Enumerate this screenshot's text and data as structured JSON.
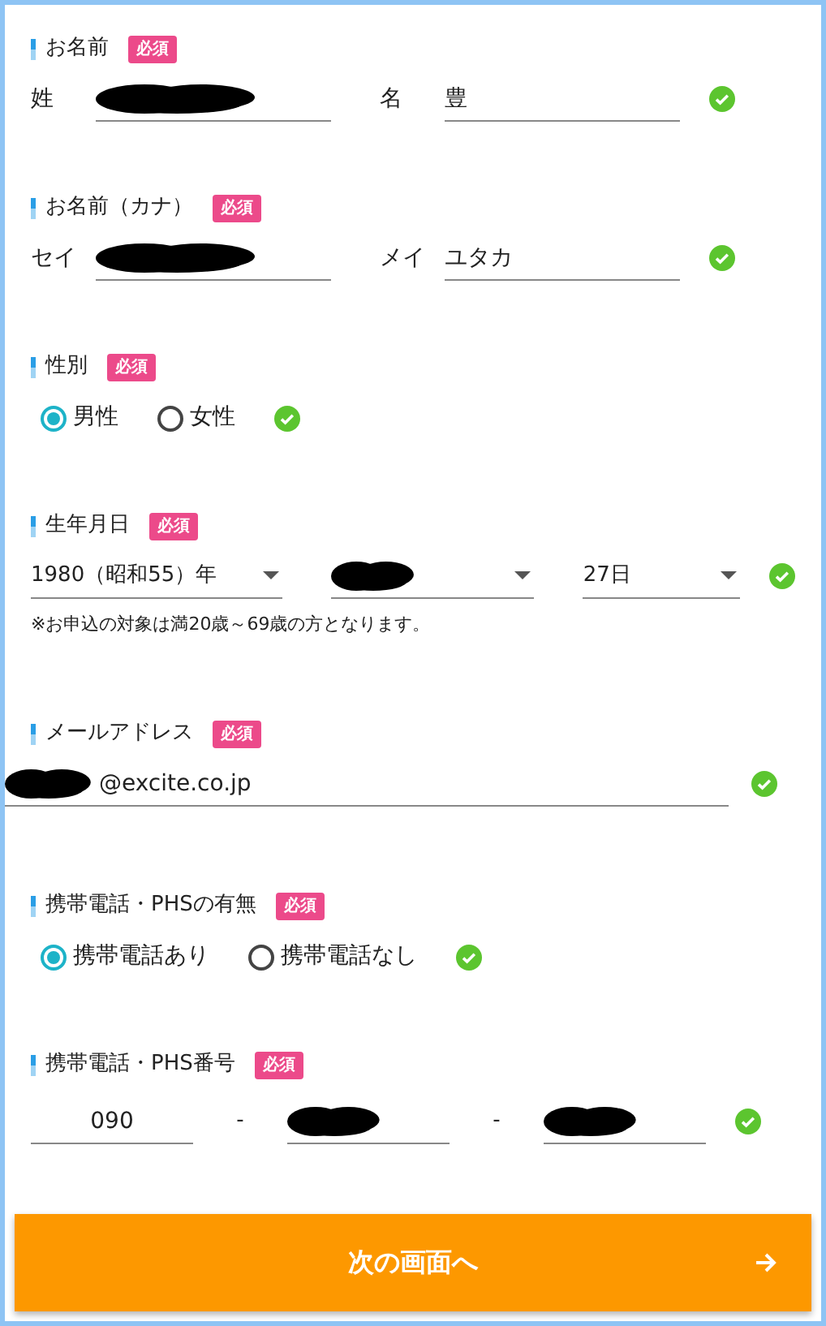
{
  "sections": [
    {
      "kind": "pair",
      "title": "お名前",
      "required": "必須",
      "valid": true,
      "fields": [
        {
          "label": "姓",
          "redacted": true
        },
        {
          "label": "名",
          "value": "豊"
        }
      ]
    },
    {
      "kind": "pair",
      "title": "お名前（カナ）",
      "required": "必須",
      "valid": true,
      "fields": [
        {
          "label": "セイ",
          "redacted": true
        },
        {
          "label": "メイ",
          "value": "ユタカ"
        }
      ]
    },
    {
      "kind": "radio",
      "title": "性別",
      "required": "必須",
      "valid": true,
      "options": [
        {
          "label": "男性",
          "selected": true
        },
        {
          "label": "女性",
          "selected": false
        }
      ]
    },
    {
      "kind": "date",
      "title": "生年月日",
      "required": "必須",
      "valid": true,
      "selects": [
        {
          "value": "1980（昭和55）年"
        },
        {
          "redacted": true
        },
        {
          "value": "27日"
        }
      ],
      "note": "※お申込の対象は満20歳～69歳の方となります。"
    },
    {
      "kind": "text",
      "title": "メールアドレス",
      "required": "必須",
      "valid": true,
      "field": {
        "value": "@excite.co.jp",
        "redacted": true
      }
    },
    {
      "kind": "radio",
      "title": "携帯電話・PHSの有無",
      "required": "必須",
      "valid": true,
      "options": [
        {
          "label": "携帯電話あり",
          "selected": true
        },
        {
          "label": "携帯電話なし",
          "selected": false
        }
      ]
    },
    {
      "kind": "phone",
      "title": "携帯電話・PHS番号",
      "required": "必須",
      "valid": true,
      "fields": [
        {
          "value": "090"
        },
        {
          "redacted": true
        },
        {
          "redacted": true
        }
      ],
      "separators": [
        "-",
        "-"
      ]
    }
  ],
  "next_button": {
    "label": "次の画面へ"
  }
}
